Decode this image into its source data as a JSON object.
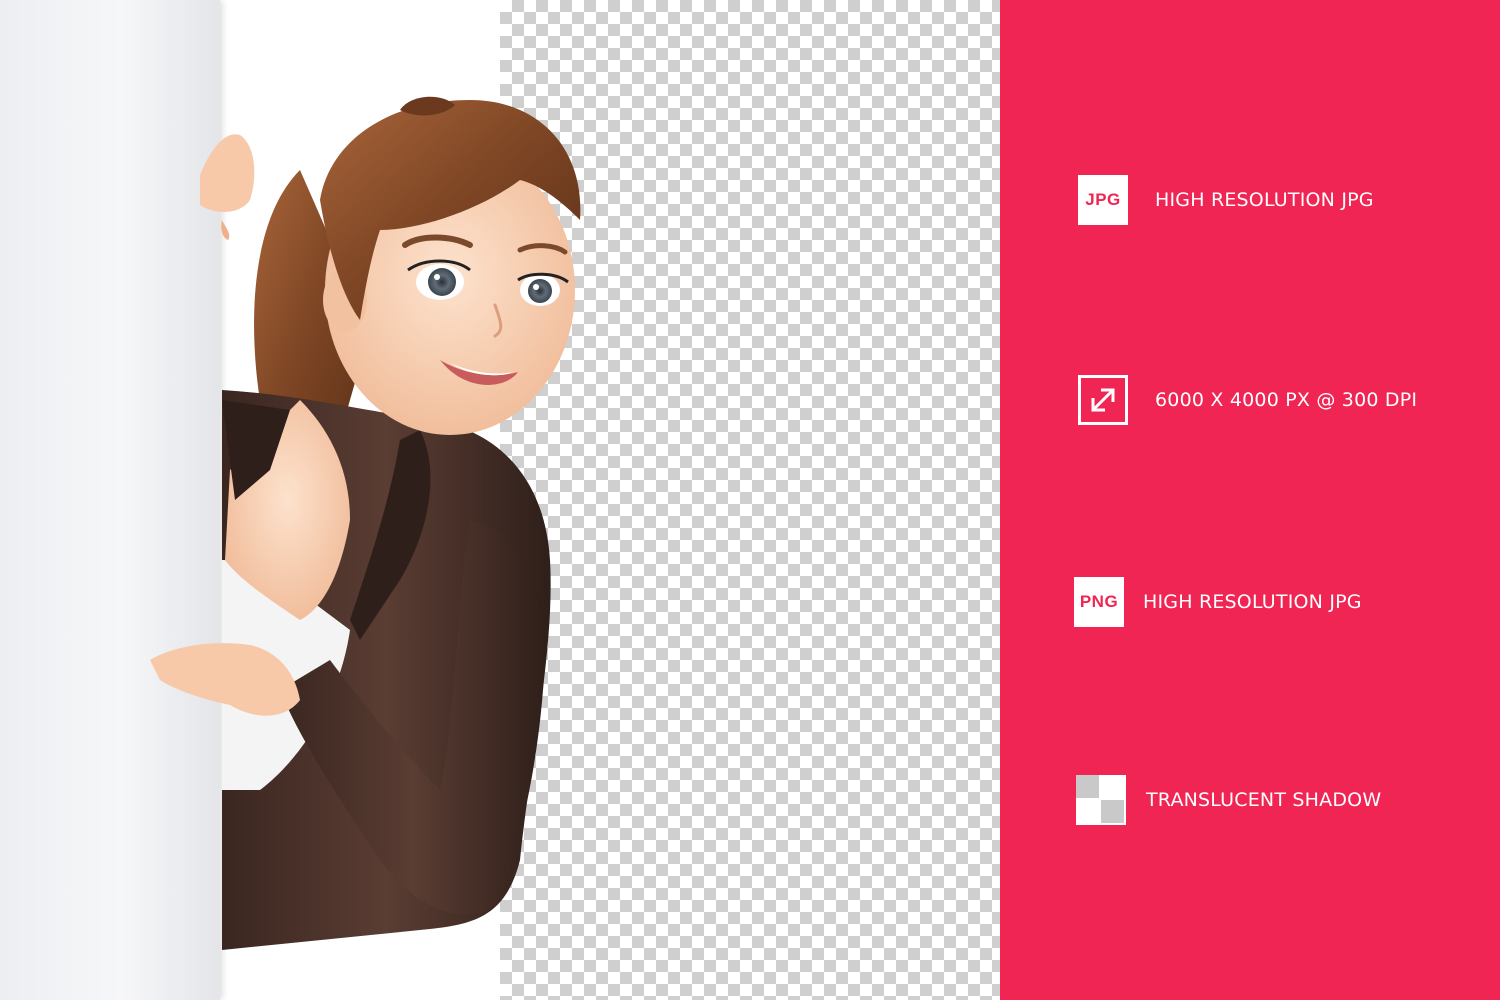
{
  "features": [
    {
      "icon": "jpg-badge-icon",
      "badge": "JPG",
      "label": "HIGH RESOLUTION JPG"
    },
    {
      "icon": "resize-arrows-icon",
      "badge": "",
      "label": "6000 X 4000 PX @ 300 DPI"
    },
    {
      "icon": "png-badge-icon",
      "badge": "PNG",
      "label": "HIGH RESOLUTION JPG"
    },
    {
      "icon": "checker-shadow-icon",
      "badge": "",
      "label": "TRANSLUCENT SHADOW"
    }
  ],
  "colors": {
    "panel": "#f02554",
    "text": "#ffffff",
    "checker": "#cfcfcf",
    "suit": "#4a3128",
    "hair": "#8a4f2c",
    "skin": "#f7cfb1"
  }
}
